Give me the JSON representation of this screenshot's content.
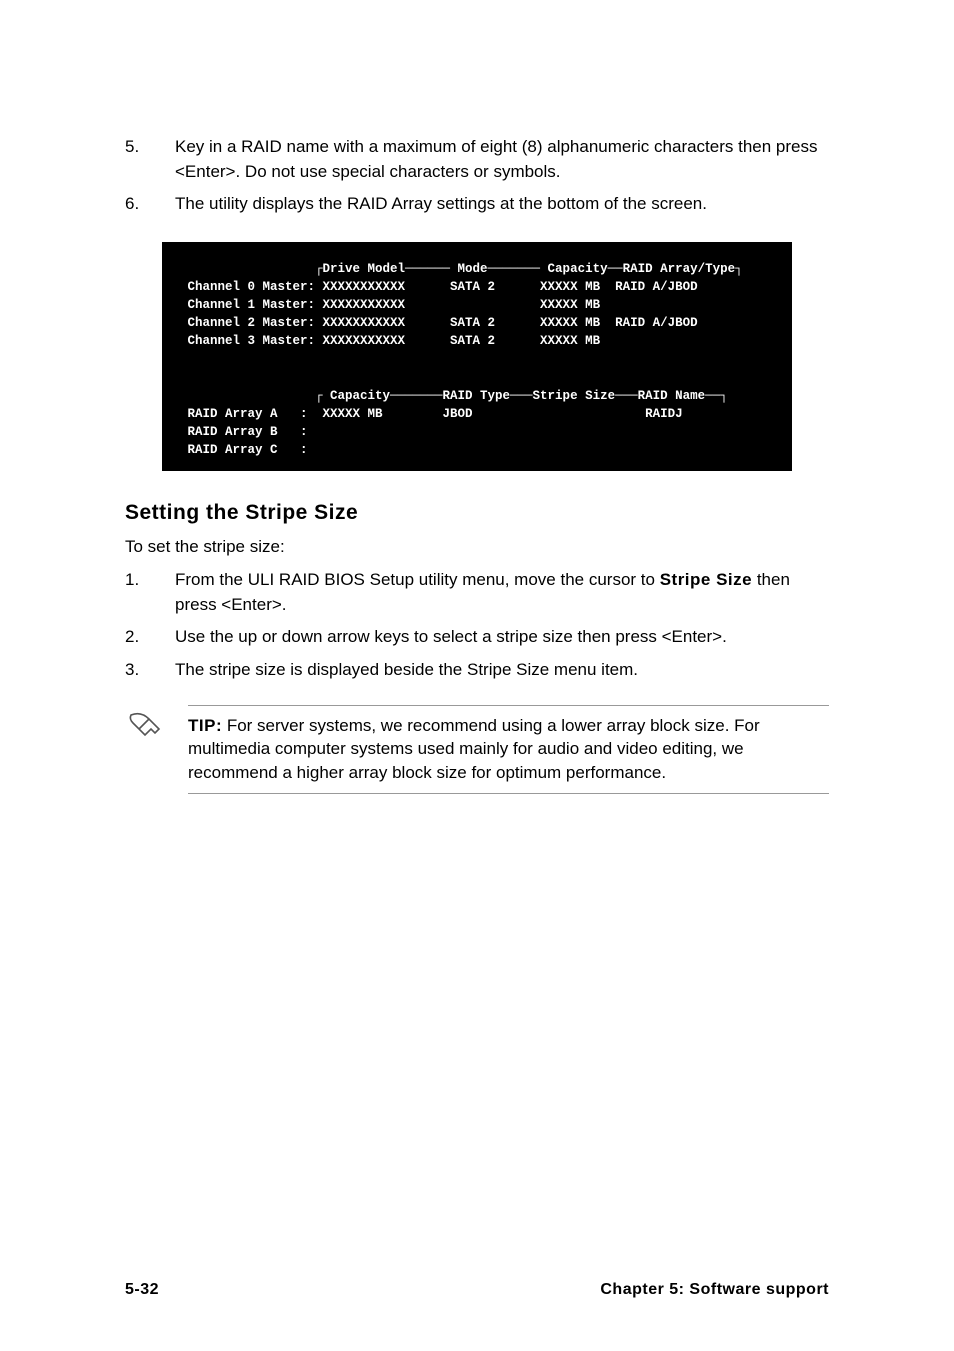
{
  "steps": [
    {
      "n": "5.",
      "text": "Key in a RAID name with a maximum of eight (8) alphanumeric characters then press <Enter>. Do not use special characters or symbols."
    },
    {
      "n": "6.",
      "text": "The utility displays the RAID Array settings at the bottom of the screen."
    }
  ],
  "bios": {
    "header": "                  ┌Drive Model────── Mode─────── Capacity──RAID Array/Type┐",
    "rows": [
      " Channel 0 Master: XXXXXXXXXXX      SATA 2      XXXXX MB  RAID A/JBOD",
      " Channel 1 Master: XXXXXXXXXXX                  XXXXX MB",
      " Channel 2 Master: XXXXXXXXXXX      SATA 2      XXXXX MB  RAID A/JBOD",
      " Channel 3 Master: XXXXXXXXXXX      SATA 2      XXXXX MB"
    ],
    "blank1": "",
    "blank2": "",
    "header2": "                  ┌ Capacity───────RAID Type───Stripe Size───RAID Name──┐",
    "rows2": [
      " RAID Array A   :  XXXXX MB        JBOD                       RAIDJ",
      " RAID Array B   :",
      " RAID Array C   :"
    ]
  },
  "section": {
    "heading": "Setting the Stripe Size",
    "intro": "To set the stripe size:",
    "items": [
      {
        "n": "1.",
        "pre": "From the ULI RAID BIOS Setup utility menu, move the cursor to ",
        "bold": "Stripe Size",
        "post": " then press <Enter>."
      },
      {
        "n": "2.",
        "pre": "Use the up or down arrow keys to select a stripe size then press <Enter>.",
        "bold": "",
        "post": ""
      },
      {
        "n": "3.",
        "pre": "The stripe size is displayed beside the Stripe Size menu item.",
        "bold": "",
        "post": ""
      }
    ]
  },
  "tip": {
    "label": "TIP:",
    "text": " For server systems, we recommend using a lower array block size. For multimedia computer systems used mainly for audio and video editing, we recommend a higher array block size for optimum performance."
  },
  "footer": {
    "page": "5-32",
    "chapter": "Chapter 5: Software support"
  }
}
